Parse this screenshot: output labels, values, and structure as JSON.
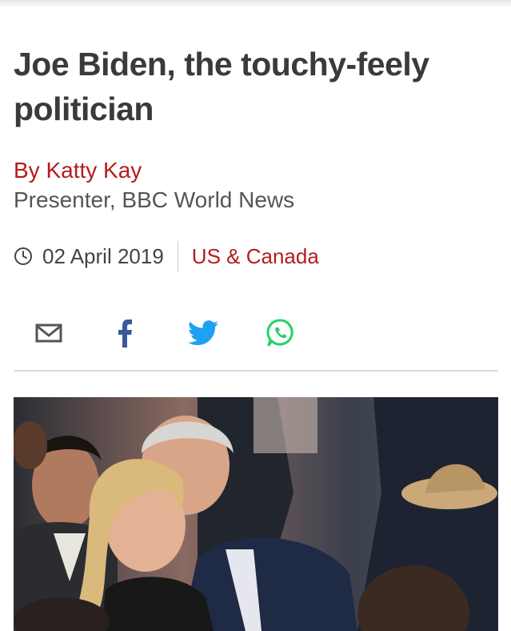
{
  "article": {
    "headline": "Joe Biden, the touchy-feely politician",
    "byline_name": "By Katty Kay",
    "byline_role": "Presenter, BBC World News",
    "date": "02 April 2019",
    "section": "US & Canada"
  },
  "share": {
    "icons": [
      "email-icon",
      "facebook-icon",
      "twitter-icon",
      "whatsapp-icon"
    ],
    "colors": {
      "email": "#555555",
      "facebook": "#3b5998",
      "twitter": "#1da1f2",
      "whatsapp": "#25d366"
    }
  },
  "theme": {
    "headline_color": "#3a3a3a",
    "accent": "#b51c1c",
    "text_secondary": "#555555"
  }
}
